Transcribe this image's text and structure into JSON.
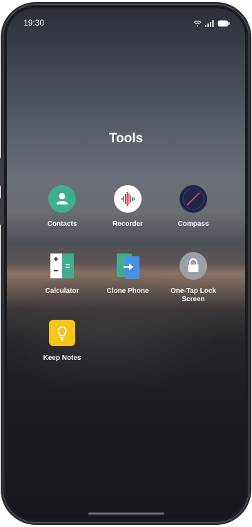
{
  "status_bar": {
    "time": "19:30",
    "icons": [
      "wifi-icon",
      "signal-icon",
      "battery-icon"
    ]
  },
  "folder": {
    "title": "Tools",
    "apps": [
      {
        "name": "Contacts",
        "icon": "contacts-icon",
        "color": "#3fae8e"
      },
      {
        "name": "Recorder",
        "icon": "recorder-icon",
        "color": "#ffffff"
      },
      {
        "name": "Compass",
        "icon": "compass-icon",
        "color": "#1f2547"
      },
      {
        "name": "Calculator",
        "icon": "calculator-icon",
        "color": "#3fae8e"
      },
      {
        "name": "Clone Phone",
        "icon": "clone-phone-icon",
        "color": "#4a90e2"
      },
      {
        "name": "One-Tap Lock Screen",
        "icon": "lock-icon",
        "color": "#9d9fa8"
      },
      {
        "name": "Keep Notes",
        "icon": "notes-icon",
        "color": "#f5c518"
      }
    ]
  }
}
